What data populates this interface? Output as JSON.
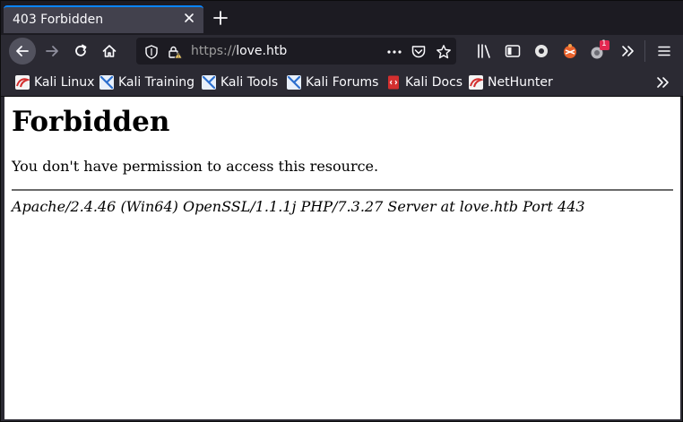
{
  "tab": {
    "title": "403 Forbidden"
  },
  "url": {
    "scheme": "https://",
    "host": "love.htb"
  },
  "toolbar": {
    "badge_count": "1"
  },
  "bookmarks": [
    {
      "label": "Kali Linux",
      "icon": "kali-dragon-icon"
    },
    {
      "label": "Kali Training",
      "icon": "kali-training-icon"
    },
    {
      "label": "Kali Tools",
      "icon": "kali-tools-icon"
    },
    {
      "label": "Kali Forums",
      "icon": "kali-forums-icon"
    },
    {
      "label": "Kali Docs",
      "icon": "kali-docs-icon"
    },
    {
      "label": "NetHunter",
      "icon": "nethunter-icon"
    }
  ],
  "page": {
    "heading": "Forbidden",
    "message": "You don't have permission to access this resource.",
    "address": "Apache/2.4.46 (Win64) OpenSSL/1.1.1j PHP/7.3.27 Server at love.htb Port 443"
  },
  "colors": {
    "accent": "#0a84ff",
    "chrome": "#2b2a33",
    "tabstrip": "#1c1b22",
    "badge": "#e22850"
  }
}
